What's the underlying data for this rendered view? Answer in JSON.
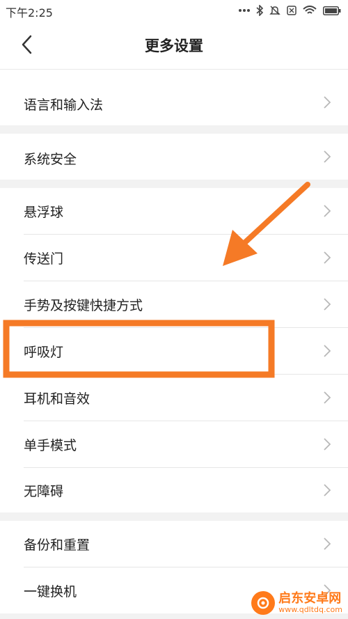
{
  "status_bar": {
    "time": "下午2:25",
    "icons": [
      "more-dots-icon",
      "bluetooth-icon",
      "mute-icon",
      "sim-icon",
      "wifi-icon",
      "battery-icon"
    ]
  },
  "header": {
    "title": "更多设置",
    "back_icon": "chevron-left-icon"
  },
  "settings": {
    "group1": {
      "item1": "语言和输入法"
    },
    "group2": {
      "item1": "系统安全"
    },
    "group3": {
      "item1": "悬浮球",
      "item2": "传送门",
      "item3": "手势及按键快捷方式",
      "item4": "呼吸灯",
      "item5": "耳机和音效",
      "item6": "单手模式",
      "item7": "无障碍"
    },
    "group4": {
      "item1": "备份和重置",
      "item2": "一键换机"
    }
  },
  "annotations": {
    "arrow_color": "#f57a26",
    "highlight_box_color": "#f57a26",
    "highlighted_item": "呼吸灯"
  },
  "watermark": {
    "name": "启东安卓网",
    "url": "www.qdltdq.com"
  },
  "colors": {
    "background": "#ffffff",
    "group_gap": "#f2f2f2",
    "divider": "#e6e6e6",
    "chevron": "#b8b8b8"
  }
}
